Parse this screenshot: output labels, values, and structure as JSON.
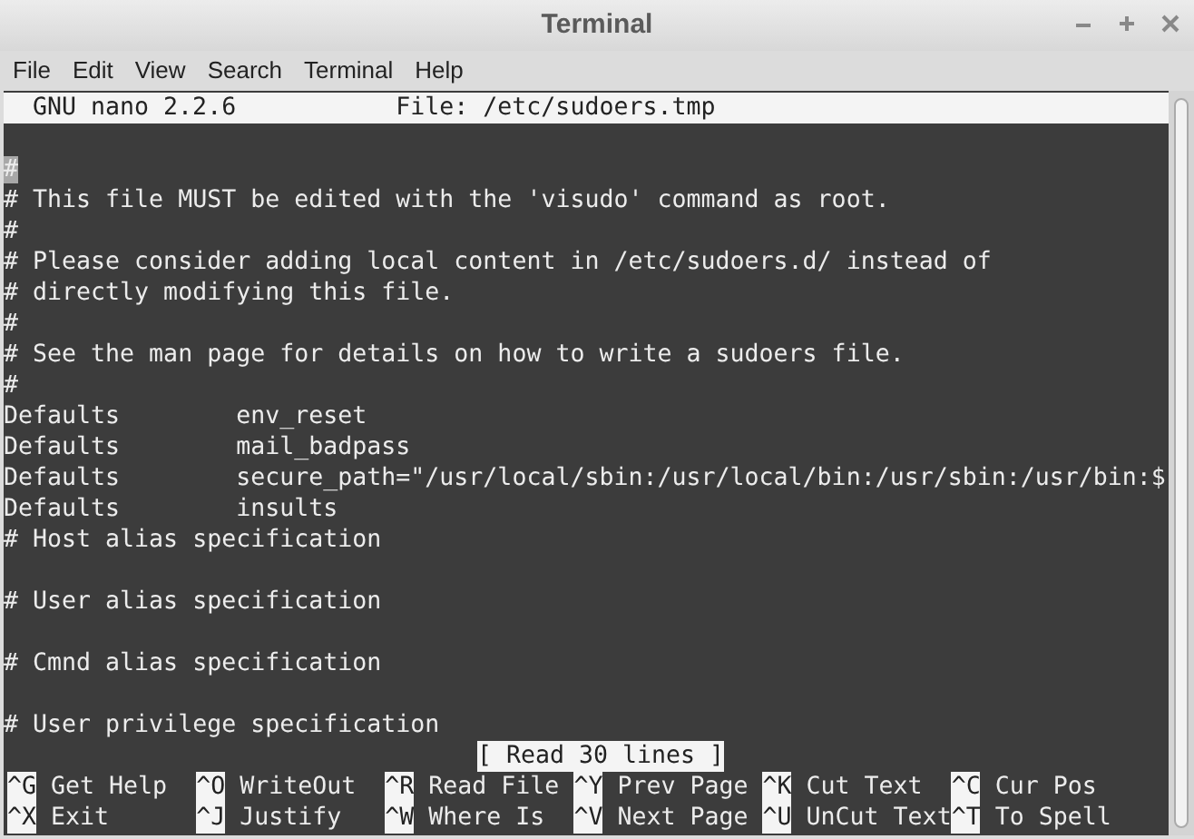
{
  "window": {
    "title": "Terminal"
  },
  "menu": [
    "File",
    "Edit",
    "View",
    "Search",
    "Terminal",
    "Help"
  ],
  "nano_header": {
    "program": "GNU nano 2.2.6",
    "file": "File: /etc/sudoers.tmp"
  },
  "lines": [
    {
      "text": "#",
      "cursor": true
    },
    {
      "text": "# This file MUST be edited with the 'visudo' command as root.",
      "cursor": false
    },
    {
      "text": "#",
      "cursor": false
    },
    {
      "text": "# Please consider adding local content in /etc/sudoers.d/ instead of",
      "cursor": false
    },
    {
      "text": "# directly modifying this file.",
      "cursor": false
    },
    {
      "text": "#",
      "cursor": false
    },
    {
      "text": "# See the man page for details on how to write a sudoers file.",
      "cursor": false
    },
    {
      "text": "#",
      "cursor": false
    },
    {
      "text": "Defaults        env_reset",
      "cursor": false
    },
    {
      "text": "Defaults        mail_badpass",
      "cursor": false
    },
    {
      "text": "Defaults        secure_path=\"/usr/local/sbin:/usr/local/bin:/usr/sbin:/usr/bin:$",
      "cursor": false
    },
    {
      "text": "Defaults        insults",
      "cursor": false
    },
    {
      "text": "# Host alias specification",
      "cursor": false,
      "blank_after": true
    },
    {
      "text": "# User alias specification",
      "cursor": false,
      "blank_after": true
    },
    {
      "text": "# Cmnd alias specification",
      "cursor": false,
      "blank_after": true
    },
    {
      "text": "# User privilege specification",
      "cursor": false
    }
  ],
  "status_message": "[ Read 30 lines ]",
  "shortcuts": [
    [
      {
        "key": "^G",
        "label": "Get Help"
      },
      {
        "key": "^O",
        "label": "WriteOut"
      },
      {
        "key": "^R",
        "label": "Read File"
      },
      {
        "key": "^Y",
        "label": "Prev Page"
      },
      {
        "key": "^K",
        "label": "Cut Text"
      },
      {
        "key": "^C",
        "label": "Cur Pos"
      }
    ],
    [
      {
        "key": "^X",
        "label": "Exit"
      },
      {
        "key": "^J",
        "label": "Justify"
      },
      {
        "key": "^W",
        "label": "Where Is"
      },
      {
        "key": "^V",
        "label": "Next Page"
      },
      {
        "key": "^U",
        "label": "UnCut Text"
      },
      {
        "key": "^T",
        "label": "To Spell"
      }
    ]
  ]
}
